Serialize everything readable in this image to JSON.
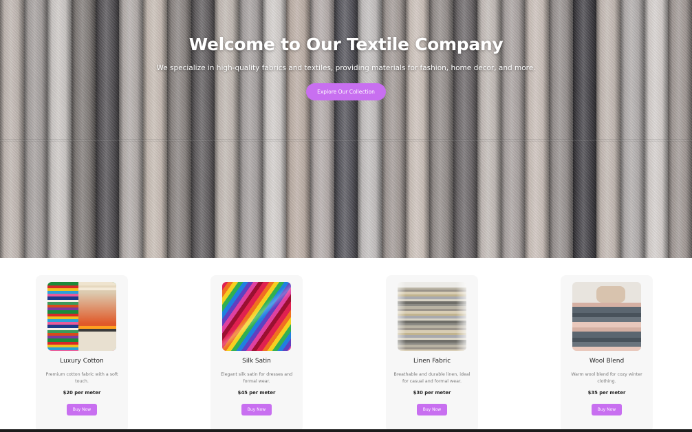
{
  "hero": {
    "title": "Welcome to Our Textile Company",
    "subtitle": "We specialize in high-quality fabrics and textiles, providing materials for fashion, home decor, and more.",
    "cta_label": "Explore Our Collection",
    "roll_colors": [
      "#d4cac4",
      "#b8b2b0",
      "#e3dedb",
      "#8f8986",
      "#5e5b5f",
      "#c7c0bd",
      "#ddd1c8",
      "#9a9390",
      "#6e6a6c",
      "#d6cdc6",
      "#bab4b3",
      "#e9e4e1",
      "#d2c3b9",
      "#c8bfbd",
      "#5f5e66",
      "#d9d5d4",
      "#b5aca8",
      "#e2d6ce",
      "#a59e9b",
      "#7a7577",
      "#d8d0cb",
      "#bdb5b3",
      "#e0d4cd",
      "#a8a19f",
      "#4d4b51",
      "#d8cdc6",
      "#c6c1c0",
      "#ebe5e2",
      "#b3aaa6"
    ]
  },
  "products": [
    {
      "name": "Luxury Cotton",
      "description": "Premium cotton fabric with a soft touch.",
      "price": "$20 per meter",
      "button": "Buy Now",
      "image_icon": "folded-cotton-fabrics-image"
    },
    {
      "name": "Silk Satin",
      "description": "Elegant silk satin for dresses and formal wear.",
      "price": "$45 per meter",
      "button": "Buy Now",
      "image_icon": "colorful-silk-satin-image"
    },
    {
      "name": "Linen Fabric",
      "description": "Breathable and durable linen, ideal for casual and formal wear.",
      "price": "$30 per meter",
      "button": "Buy Now",
      "image_icon": "stacked-linen-image"
    },
    {
      "name": "Wool Blend",
      "description": "Warm wool blend for cozy winter clothing.",
      "price": "$35 per meter",
      "button": "Buy Now",
      "image_icon": "folded-wool-sweaters-image"
    }
  ],
  "colors": {
    "accent": "#c86ff0",
    "card_background": "#f7f7f7"
  }
}
